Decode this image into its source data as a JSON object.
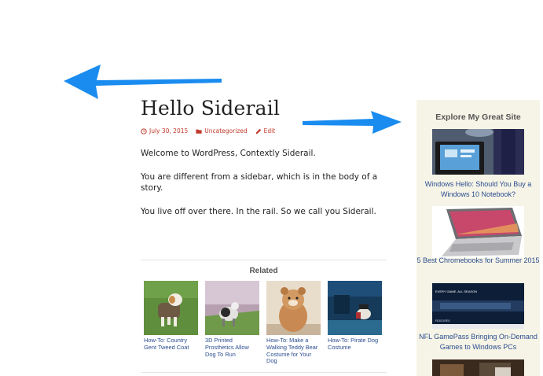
{
  "post": {
    "title": "Hello Siderail",
    "meta": {
      "date": "July 30, 2015",
      "category": "Uncategorized",
      "edit": "Edit"
    },
    "paragraphs": [
      "Welcome to WordPress, Contextly Siderail.",
      "You are different from a sidebar, which is in the body of a story.",
      "You live off over there. In the rail. So we call you Siderail."
    ]
  },
  "related": {
    "title": "Related",
    "items": [
      {
        "caption": "How-To: Country Gent Tweed Coat"
      },
      {
        "caption": "3D Printed Prosthetics Allow Dog To Run"
      },
      {
        "caption": "How-To: Make a Walking Teddy Bear Costume for Your Dog"
      },
      {
        "caption": "How-To: Pirate Dog Costume"
      }
    ]
  },
  "siderail": {
    "title": "Explore My Great Site",
    "items": [
      {
        "caption": "Windows Hello: Should You Buy a Windows 10 Notebook?"
      },
      {
        "caption": "5 Best Chromebooks for Summer 2015"
      },
      {
        "caption": "NFL GamePass Bringing On-Demand Games to Windows PCs",
        "thumb_text": [
          "EVERY GAME, ALL SEASON",
          "FEATURES"
        ]
      }
    ]
  },
  "colors": {
    "arrow": "#1a8cf0",
    "rail_bg": "#f6f4e6",
    "link": "#2a4c8f",
    "meta": "#c0392b"
  },
  "icons": [
    "left-arrow-annotation-icon",
    "right-arrow-annotation-icon",
    "clock-icon",
    "folder-icon",
    "pencil-icon"
  ]
}
